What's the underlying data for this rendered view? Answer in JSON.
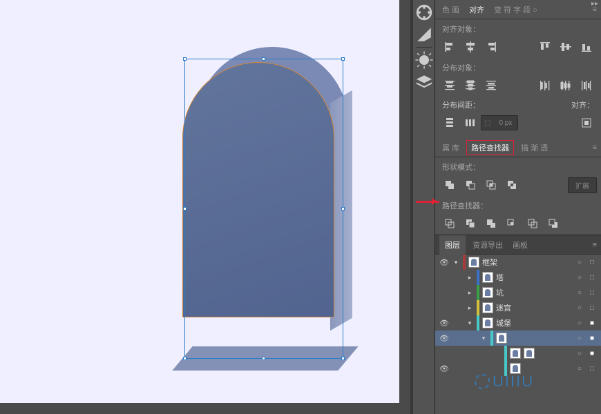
{
  "align_panel": {
    "tabs": [
      "色 画",
      "对齐",
      "变 符 字 段 ○"
    ],
    "sections": {
      "align_objects": "对齐对象：",
      "distribute_objects": "分布对象：",
      "distribute_spacing": "分布间距：",
      "align_to": "对齐："
    },
    "spacing_value": "0 px"
  },
  "pathfinder_panel": {
    "tabs_left": "属 库",
    "tab_active": "路径查找器",
    "tabs_right": "描 渐 透",
    "shape_modes": "形状模式：",
    "expand_label": "扩展",
    "pathfinders": "路径查找器："
  },
  "layers_panel": {
    "tabs": {
      "active": "图层",
      "t2": "资源导出",
      "t3": "画板"
    },
    "rows": [
      {
        "eye": true,
        "twist": "▾",
        "color": "#a83a3a",
        "name": "框架",
        "target": "○",
        "sel": "□",
        "depth": 0
      },
      {
        "eye": false,
        "twist": "▸",
        "color": "#3b70c9",
        "name": "塔",
        "target": "○",
        "sel": "□",
        "depth": 1
      },
      {
        "eye": false,
        "twist": "▸",
        "color": "#3aa045",
        "name": "坑",
        "target": "○",
        "sel": "□",
        "depth": 1
      },
      {
        "eye": false,
        "twist": "▸",
        "color": "#d4c23c",
        "name": "迷宫",
        "target": "○",
        "sel": "□",
        "depth": 1
      },
      {
        "eye": true,
        "twist": "▾",
        "color": "#49c8c8",
        "name": "城堡",
        "target": "○",
        "sel": "■",
        "depth": 1
      },
      {
        "eye": true,
        "twist": "▾",
        "color": "#49c8c8",
        "name": "",
        "target": "○",
        "sel": "■",
        "depth": 2,
        "selected": true
      },
      {
        "eye": false,
        "twist": "",
        "color": "#49c8c8",
        "name": "",
        "target": "○",
        "sel": "■",
        "depth": 3,
        "thumbs": 2
      },
      {
        "eye": true,
        "twist": "",
        "color": "#49c8c8",
        "name": "",
        "target": "○",
        "sel": "□",
        "depth": 3,
        "thumbs": 1
      }
    ]
  }
}
